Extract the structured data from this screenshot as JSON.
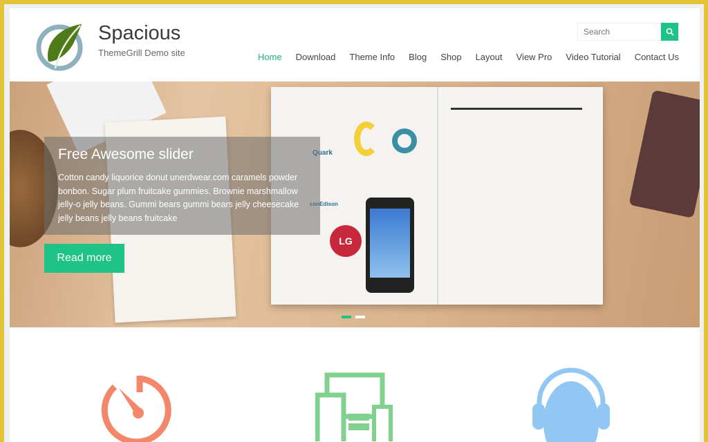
{
  "header": {
    "site_title": "Spacious",
    "tagline": "ThemeGrill Demo site",
    "search": {
      "placeholder": "Search",
      "icon": "search-icon"
    },
    "nav": [
      {
        "label": "Home",
        "active": true
      },
      {
        "label": "Download"
      },
      {
        "label": "Theme Info"
      },
      {
        "label": "Blog"
      },
      {
        "label": "Shop"
      },
      {
        "label": "Layout"
      },
      {
        "label": "View Pro"
      },
      {
        "label": "Video Tutorial"
      },
      {
        "label": "Contact Us"
      }
    ]
  },
  "slider": {
    "title": "Free Awesome slider",
    "text": "Cotton candy liquorice donut unerdwear.com caramels powder bonbon. Sugar plum fruitcake gummies. Brownie marshmallow jelly-o jelly beans. Gummi bears gummi bears jelly cheesecake jelly beans jelly beans fruitcake",
    "button": "Read more",
    "slide_count": 2,
    "active_slide": 1,
    "image_logos": [
      "Quark",
      "conEdison",
      "LG"
    ]
  },
  "features": {
    "icons": [
      "speedometer-icon",
      "responsive-devices-icon",
      "headset-support-icon"
    ]
  },
  "colors": {
    "accent": "#1fc287",
    "frame": "#e3c437",
    "speed": "#f2876a",
    "devices": "#7fd18d",
    "support": "#93c7f3"
  }
}
